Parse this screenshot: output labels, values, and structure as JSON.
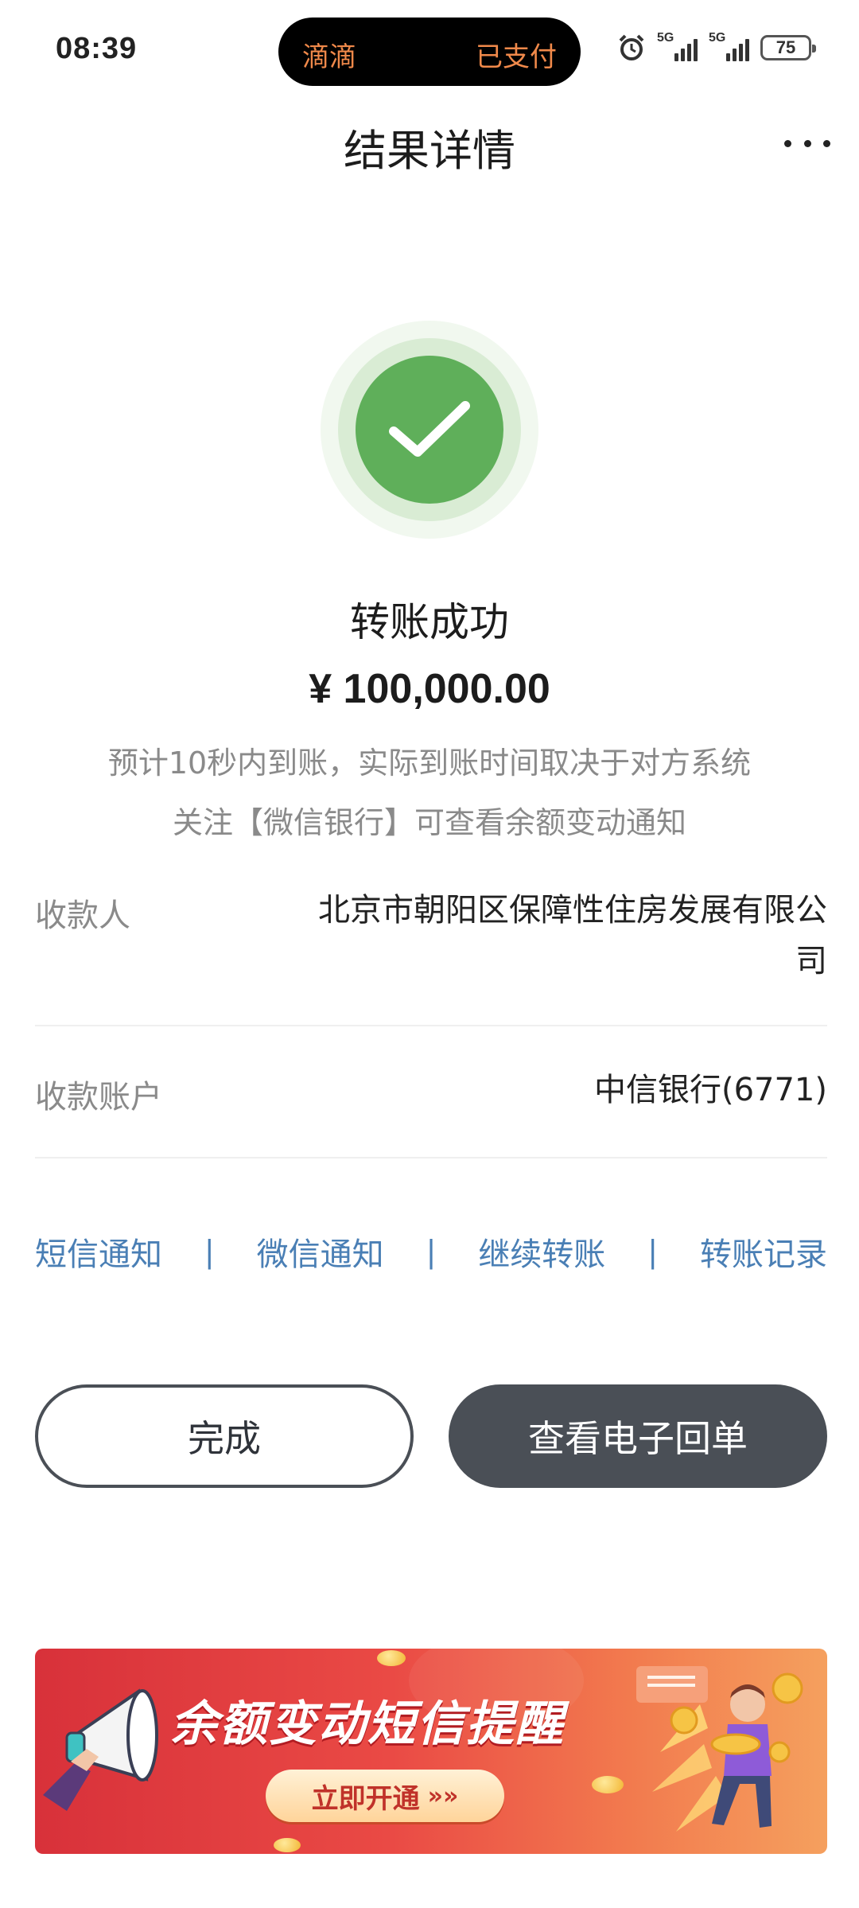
{
  "status_bar": {
    "time": "08:39",
    "island_app": "滴滴",
    "island_status": "已支付",
    "signal1_label": "5G",
    "signal2_label": "5G",
    "battery": "75"
  },
  "nav": {
    "title": "结果详情"
  },
  "result": {
    "title": "转账成功",
    "amount": "¥ 100,000.00",
    "note_arrival": "预计10秒内到账，实际到账时间取决于对方系统",
    "note_follow": "关注【微信银行】可查看余额变动通知"
  },
  "details": [
    {
      "label": "收款人",
      "value": "北京市朝阳区保障性住房发展有限公司"
    },
    {
      "label": "收款账户",
      "value": "中信银行(6771)"
    }
  ],
  "links": {
    "sms": "短信通知",
    "wechat": "微信通知",
    "continue": "继续转账",
    "records": "转账记录",
    "separator": "|"
  },
  "buttons": {
    "done": "完成",
    "receipt": "查看电子回单"
  },
  "banner": {
    "title": "余额变动短信提醒",
    "cta": "立即开通",
    "cta_arrows": "»»"
  },
  "colors": {
    "success_green": "#5faf5a",
    "link_blue": "#4a7fb5",
    "button_dark": "#4a4f56",
    "island_text": "#f0894a",
    "banner_red": "#d8313a"
  },
  "icons": {
    "more": "more-dots-icon",
    "success": "checkmark-icon",
    "alarm": "alarm-icon",
    "banner_left": "megaphone-icon",
    "banner_right": "person-coins-illustration"
  }
}
